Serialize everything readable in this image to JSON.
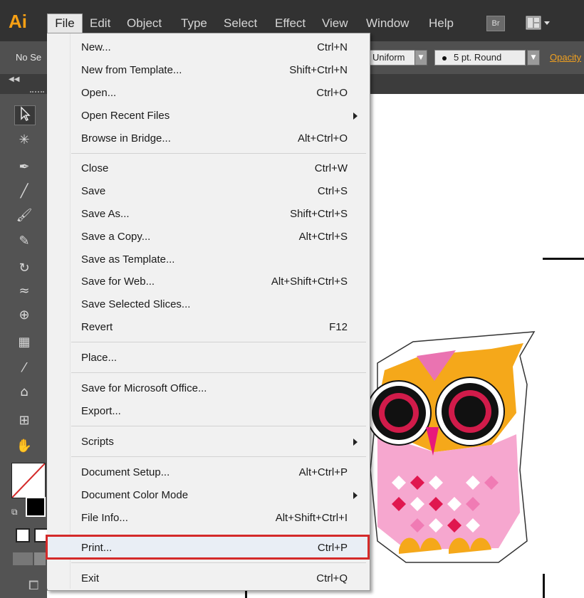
{
  "app": {
    "logo_text": "Ai",
    "brand_color": "#f7a014"
  },
  "menubar": {
    "items": [
      "File",
      "Edit",
      "Object",
      "Type",
      "Select",
      "Effect",
      "View",
      "Window",
      "Help"
    ],
    "bridge_label": "Br"
  },
  "control_bar": {
    "selection_text": "No Se",
    "profile_value": "Uniform",
    "brush_value": "5 pt. Round",
    "opacity_label": "Opacity"
  },
  "file_menu": {
    "items": [
      {
        "label": "New...",
        "shortcut": "Ctrl+N"
      },
      {
        "label": "New from Template...",
        "shortcut": "Shift+Ctrl+N"
      },
      {
        "label": "Open...",
        "shortcut": "Ctrl+O"
      },
      {
        "label": "Open Recent Files",
        "shortcut": ""
      },
      {
        "label": "Browse in Bridge...",
        "shortcut": "Alt+Ctrl+O"
      },
      {
        "label": "Close",
        "shortcut": "Ctrl+W"
      },
      {
        "label": "Save",
        "shortcut": "Ctrl+S"
      },
      {
        "label": "Save As...",
        "shortcut": "Shift+Ctrl+S"
      },
      {
        "label": "Save a Copy...",
        "shortcut": "Alt+Ctrl+S"
      },
      {
        "label": "Save as Template...",
        "shortcut": ""
      },
      {
        "label": "Save for Web...",
        "shortcut": "Alt+Shift+Ctrl+S"
      },
      {
        "label": "Save Selected Slices...",
        "shortcut": ""
      },
      {
        "label": "Revert",
        "shortcut": "F12"
      },
      {
        "label": "Place...",
        "shortcut": ""
      },
      {
        "label": "Save for Microsoft Office...",
        "shortcut": ""
      },
      {
        "label": "Export...",
        "shortcut": ""
      },
      {
        "label": "Scripts",
        "shortcut": ""
      },
      {
        "label": "Document Setup...",
        "shortcut": "Alt+Ctrl+P"
      },
      {
        "label": "Document Color Mode",
        "shortcut": ""
      },
      {
        "label": "File Info...",
        "shortcut": "Alt+Shift+Ctrl+I"
      },
      {
        "label": "Print...",
        "shortcut": "Ctrl+P"
      },
      {
        "label": "Exit",
        "shortcut": "Ctrl+Q"
      }
    ],
    "highlight_color": "#d42a2a"
  }
}
